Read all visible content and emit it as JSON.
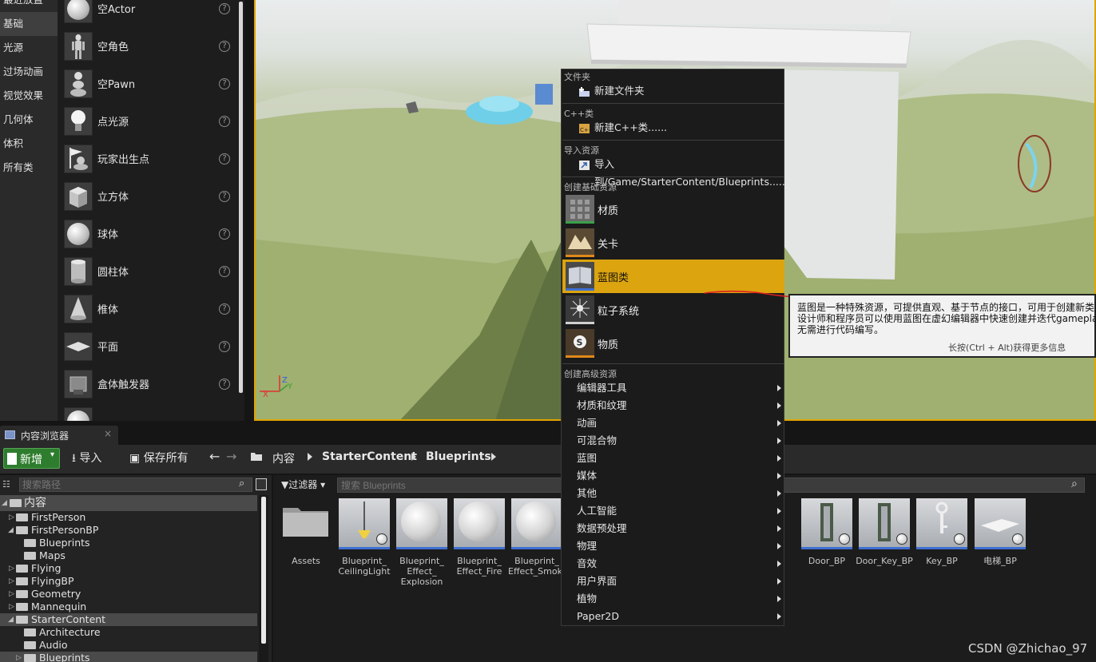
{
  "place_actors": {
    "categories": [
      "最近放置",
      "基础",
      "光源",
      "过场动画",
      "视觉效果",
      "几何体",
      "体积",
      "所有类"
    ],
    "items": [
      {
        "label": "空Actor",
        "icon": "sphere-icon"
      },
      {
        "label": "空角色",
        "icon": "mannequin-icon"
      },
      {
        "label": "空Pawn",
        "icon": "pawn-icon"
      },
      {
        "label": "点光源",
        "icon": "light-bulb-icon"
      },
      {
        "label": "玩家出生点",
        "icon": "player-start-icon"
      },
      {
        "label": "立方体",
        "icon": "cube-icon"
      },
      {
        "label": "球体",
        "icon": "sphere-icon"
      },
      {
        "label": "圆柱体",
        "icon": "cylinder-icon"
      },
      {
        "label": "椎体",
        "icon": "cone-icon"
      },
      {
        "label": "平面",
        "icon": "plane-icon"
      },
      {
        "label": "盒体触发器",
        "icon": "box-trigger-icon"
      }
    ],
    "help_glyph": "?"
  },
  "viewport": {
    "axis_x": "X",
    "axis_y": "Y",
    "axis_z": "Z"
  },
  "content_browser": {
    "tab_label": "内容浏览器",
    "tab_close": "×",
    "new_button": "新增",
    "import_button": "导入",
    "save_all_button": "保存所有",
    "breadcrumb": [
      "内容",
      "StarterContent",
      "Blueprints"
    ],
    "path_search_placeholder": "搜索路径",
    "filter_button": "过滤器",
    "asset_search_placeholder": "搜索 Blueprints",
    "tree": [
      {
        "name": "内容",
        "level": 0,
        "expanded": true,
        "selected": true
      },
      {
        "name": "FirstPerson",
        "level": 1,
        "expanded": false
      },
      {
        "name": "FirstPersonBP",
        "level": 1,
        "expanded": true
      },
      {
        "name": "Blueprints",
        "level": 2
      },
      {
        "name": "Maps",
        "level": 2
      },
      {
        "name": "Flying",
        "level": 1,
        "expanded": false
      },
      {
        "name": "FlyingBP",
        "level": 1,
        "expanded": false
      },
      {
        "name": "Geometry",
        "level": 1,
        "expanded": false
      },
      {
        "name": "Mannequin",
        "level": 1,
        "expanded": false
      },
      {
        "name": "StarterContent",
        "level": 1,
        "expanded": true,
        "selected": true
      },
      {
        "name": "Architecture",
        "level": 2
      },
      {
        "name": "Audio",
        "level": 2
      },
      {
        "name": "Blueprints",
        "level": 2,
        "expanded": false
      }
    ],
    "assets": [
      {
        "name": "Assets",
        "kind": "folder"
      },
      {
        "name": "Blueprint_ CeilingLight",
        "kind": "light"
      },
      {
        "name": "Blueprint_ Effect_ Explosion",
        "kind": "sphere"
      },
      {
        "name": "Blueprint_ Effect_Fire",
        "kind": "sphere"
      },
      {
        "name": "Blueprint_ Effect_Smoke",
        "kind": "sphere"
      },
      {
        "name": "Door_BP",
        "kind": "door"
      },
      {
        "name": "Door_Key_BP",
        "kind": "door"
      },
      {
        "name": "Key_BP",
        "kind": "key"
      },
      {
        "name": "电梯_BP",
        "kind": "plate"
      }
    ]
  },
  "context_menu": {
    "sections": {
      "folder": "文件夹",
      "cpp": "C++类",
      "import": "导入资源",
      "basic": "创建基础资源",
      "advanced": "创建高级资源"
    },
    "new_folder": "新建文件夹",
    "new_cpp_class": "新建C++类......",
    "import_to": "导入到/Game/StarterContent/Blueprints......",
    "basic_items": [
      {
        "label": "材质",
        "accent": "#3aa04a"
      },
      {
        "label": "关卡",
        "accent": "#e0891a"
      },
      {
        "label": "蓝图类",
        "accent": "#3e6fd1"
      },
      {
        "label": "粒子系统",
        "accent": "#d0d0d0"
      },
      {
        "label": "物质",
        "accent": "#e0891a"
      }
    ],
    "highlighted": "蓝图类",
    "advanced_items": [
      "编辑器工具",
      "材质和纹理",
      "动画",
      "可混合物",
      "蓝图",
      "媒体",
      "其他",
      "人工智能",
      "数据预处理",
      "物理",
      "音效",
      "用户界面",
      "植物",
      "Paper2D"
    ]
  },
  "tooltip": {
    "line1": "蓝图是一种特殊资源，可提供直观、基于节点的接口，可用于创建新类型",
    "line2": "设计师和程序员可以使用蓝图在虚幻编辑器中快速创建并迭代gameplay",
    "line3": "无需进行代码编写。",
    "hint": "长按(Ctrl + Alt)获得更多信息"
  },
  "watermark": "CSDN @Zhichao_97",
  "colors": {
    "highlight": "#dca40e",
    "viewport_border": "#e0a400",
    "new_button": "#2e7d2e"
  }
}
